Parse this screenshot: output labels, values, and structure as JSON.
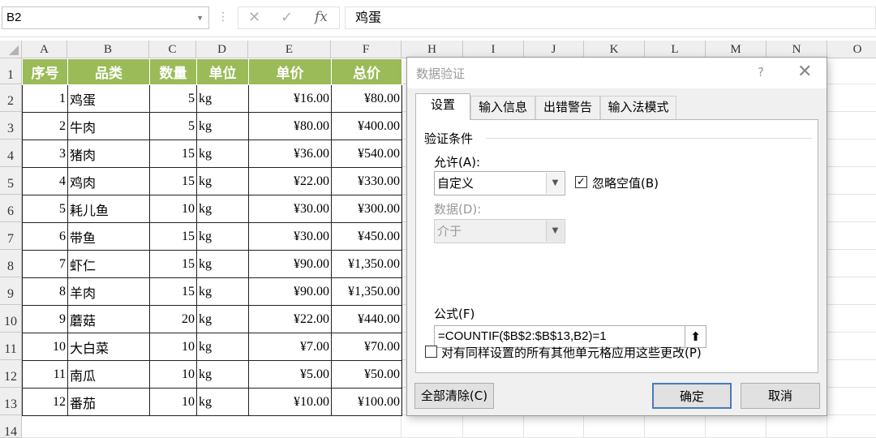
{
  "formula_bar": {
    "name_box": "B2",
    "cancel_icon": "✕",
    "enter_icon": "✓",
    "fx_icon": "fx",
    "content": "鸡蛋"
  },
  "grid": {
    "columns": [
      "A",
      "B",
      "C",
      "D",
      "E",
      "F",
      "H",
      "I",
      "J",
      "K",
      "L",
      "M",
      "N",
      "O"
    ],
    "rows": [
      "1",
      "2",
      "3",
      "4",
      "5",
      "6",
      "7",
      "8",
      "9",
      "10",
      "11",
      "12",
      "13",
      "14"
    ]
  },
  "table": {
    "headers": [
      "序号",
      "品类",
      "数量",
      "单位",
      "单价",
      "总价"
    ],
    "rows": [
      [
        "1",
        "鸡蛋",
        "5",
        "kg",
        "¥16.00",
        "¥80.00"
      ],
      [
        "2",
        "牛肉",
        "5",
        "kg",
        "¥80.00",
        "¥400.00"
      ],
      [
        "3",
        "猪肉",
        "15",
        "kg",
        "¥36.00",
        "¥540.00"
      ],
      [
        "4",
        "鸡肉",
        "15",
        "kg",
        "¥22.00",
        "¥330.00"
      ],
      [
        "5",
        "耗儿鱼",
        "10",
        "kg",
        "¥30.00",
        "¥300.00"
      ],
      [
        "6",
        "带鱼",
        "15",
        "kg",
        "¥30.00",
        "¥450.00"
      ],
      [
        "7",
        "虾仁",
        "15",
        "kg",
        "¥90.00",
        "¥1,350.00"
      ],
      [
        "8",
        "羊肉",
        "15",
        "kg",
        "¥90.00",
        "¥1,350.00"
      ],
      [
        "9",
        "蘑菇",
        "20",
        "kg",
        "¥22.00",
        "¥440.00"
      ],
      [
        "10",
        "大白菜",
        "10",
        "kg",
        "¥7.00",
        "¥70.00"
      ],
      [
        "11",
        "南瓜",
        "10",
        "kg",
        "¥5.00",
        "¥50.00"
      ],
      [
        "12",
        "番茄",
        "10",
        "kg",
        "¥10.00",
        "¥100.00"
      ]
    ]
  },
  "dialog": {
    "title": "数据验证",
    "help": "?",
    "close": "✕",
    "tabs": [
      "设置",
      "输入信息",
      "出错警告",
      "输入法模式"
    ],
    "active_tab": "设置",
    "section": "验证条件",
    "allow_label": "允许(A):",
    "allow_value": "自定义",
    "ignore_blank_label": "忽略空值(B)",
    "ignore_blank_checked": true,
    "data_label": "数据(D):",
    "data_value": "介于",
    "formula_label": "公式(F)",
    "formula_value": "=COUNTIF($B$2:$B$13,B2)=1",
    "apply_all_label": "对有同样设置的所有其他单元格应用这些更改(P)",
    "apply_all_checked": false,
    "clear_all": "全部清除(C)",
    "ok": "确定",
    "cancel": "取消"
  }
}
